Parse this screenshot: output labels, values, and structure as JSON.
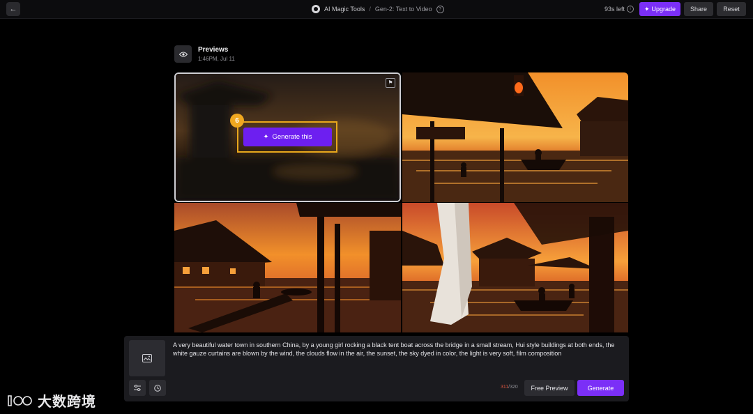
{
  "topbar": {
    "brand": "AI Magic Tools",
    "separator": "/",
    "page": "Gen-2: Text to Video",
    "credits": "93s left",
    "upgrade_label": "Upgrade",
    "share_label": "Share",
    "reset_label": "Reset"
  },
  "preview": {
    "title": "Previews",
    "date": "1:46PM, Jul 11"
  },
  "tiles": {
    "overlay_step": "6",
    "generate_this_label": "Generate this"
  },
  "prompt": {
    "text": "A very beautiful water town in southern China, by a young girl rocking a black tent boat across the bridge in a small stream, Hui style buildings at both ends, the white gauze curtains are blown by the wind, the clouds flow in the air, the sunset, the sky dyed in color, the light is very soft, film composition",
    "char_used": "311",
    "char_max": "/320",
    "free_preview_label": "Free Preview",
    "generate_label": "Generate"
  },
  "watermark": {
    "text": "大数跨境"
  },
  "colors": {
    "accent": "#7b2ff7",
    "highlight": "#e9a81c",
    "panel": "#1b1b1f"
  }
}
